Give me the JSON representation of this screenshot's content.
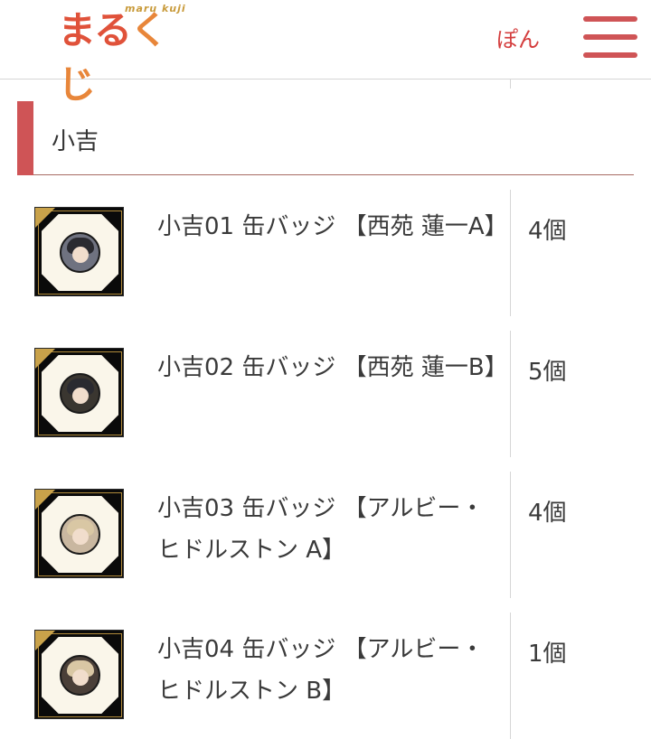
{
  "header": {
    "logo_roman": "maru kuji",
    "logo_jp_1": "ま",
    "logo_jp_2": "る",
    "logo_jp_3": "く",
    "logo_jp_4": "じ",
    "points_label": "ぽん",
    "menu_icon": "hamburger-menu-icon"
  },
  "section": {
    "title": "小吉"
  },
  "items": [
    {
      "name": "小吉01 缶バッジ 【西苑 蓮一A】",
      "qty": "4個",
      "hair_color": "#2a2a30"
    },
    {
      "name": "小吉02 缶バッジ 【西苑 蓮一B】",
      "qty": "5個",
      "hair_color": "#2a2a30"
    },
    {
      "name": "小吉03 缶バッジ 【アルビー・ヒドルストン A】",
      "qty": "4個",
      "hair_color": "#d9c7a4"
    },
    {
      "name": "小吉04 缶バッジ 【アルビー・ヒドルストン B】",
      "qty": "1個",
      "hair_color": "#d9c7a4"
    }
  ],
  "colors": {
    "accent": "#cf5456",
    "logo_red": "#e0523a",
    "logo_gold": "#c89a3a",
    "points_red": "#d43d3d"
  }
}
